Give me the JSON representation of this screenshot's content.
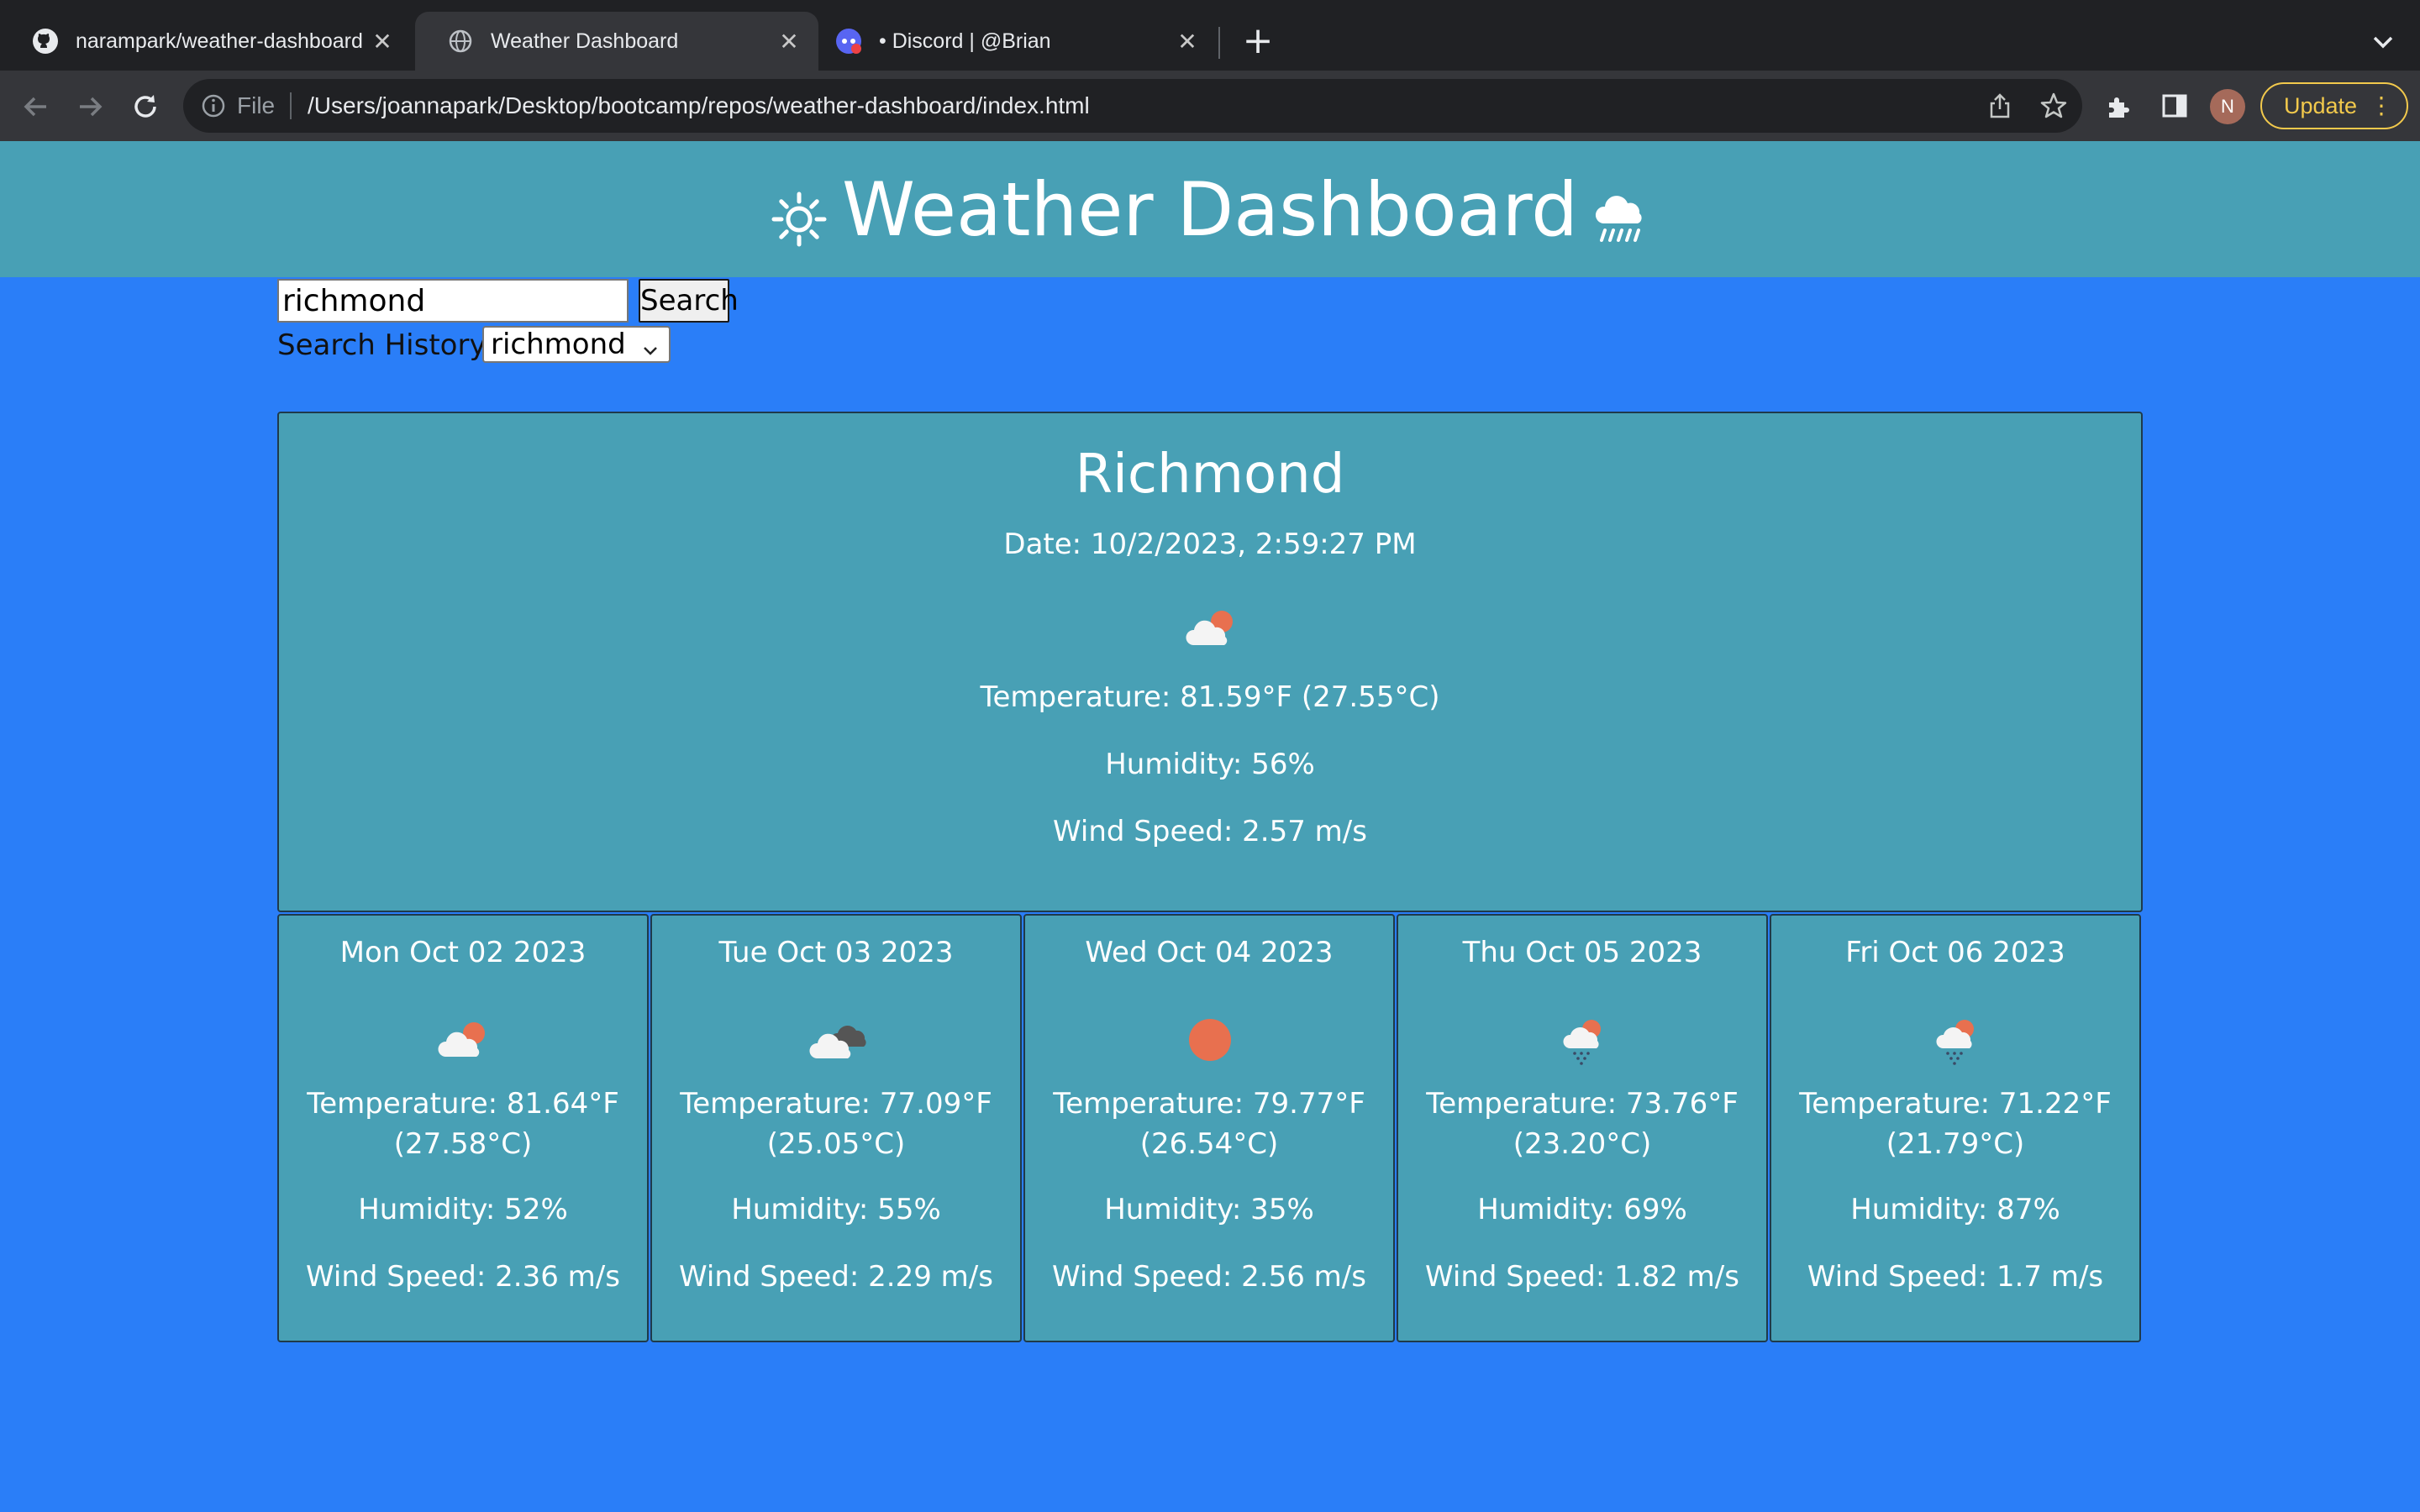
{
  "browser": {
    "tabs": [
      {
        "title": "narampark/weather-dashboard",
        "icon": "github-icon",
        "active": false
      },
      {
        "title": "Weather Dashboard",
        "icon": "globe-icon",
        "active": true
      },
      {
        "title": "• Discord | @Brian",
        "icon": "discord-icon",
        "active": false
      }
    ],
    "new_tab": "+",
    "omnibox": {
      "scheme_label": "File",
      "url": "/Users/joannapark/Desktop/bootcamp/repos/weather-dashboard/index.html"
    },
    "avatar_initial": "N",
    "update_label": "Update",
    "update_menu": "⋮"
  },
  "page": {
    "header_title": "Weather Dashboard",
    "search": {
      "value": "richmond",
      "button_label": "Search"
    },
    "history": {
      "label": "Search History:",
      "selected": "richmond"
    },
    "current": {
      "city": "Richmond",
      "date": "Date: 10/2/2023, 2:59:27 PM",
      "icon": "partly-cloudy-icon",
      "temperature": "Temperature: 81.59°F (27.55°C)",
      "humidity": "Humidity: 56%",
      "wind": "Wind Speed: 2.57 m/s"
    },
    "forecast": [
      {
        "date": "Mon Oct 02 2023",
        "icon": "partly-cloudy-icon",
        "temp_f": "Temperature: 81.64°F",
        "temp_c": "(27.58°C)",
        "humidity": "Humidity: 52%",
        "wind": "Wind Speed: 2.36 m/s"
      },
      {
        "date": "Tue Oct 03 2023",
        "icon": "broken-clouds-icon",
        "temp_f": "Temperature: 77.09°F",
        "temp_c": "(25.05°C)",
        "humidity": "Humidity: 55%",
        "wind": "Wind Speed: 2.29 m/s"
      },
      {
        "date": "Wed Oct 04 2023",
        "icon": "clear-sun-icon",
        "temp_f": "Temperature: 79.77°F",
        "temp_c": "(26.54°C)",
        "humidity": "Humidity: 35%",
        "wind": "Wind Speed: 2.56 m/s"
      },
      {
        "date": "Thu Oct 05 2023",
        "icon": "rain-cloud-icon",
        "temp_f": "Temperature: 73.76°F",
        "temp_c": "(23.20°C)",
        "humidity": "Humidity: 69%",
        "wind": "Wind Speed: 1.82 m/s"
      },
      {
        "date": "Fri Oct 06 2023",
        "icon": "rain-cloud-icon",
        "temp_f": "Temperature: 71.22°F",
        "temp_c": "(21.79°C)",
        "humidity": "Humidity: 87%",
        "wind": "Wind Speed: 1.7 m/s"
      }
    ]
  },
  "colors": {
    "page_bg": "#2a7ef8",
    "card_bg": "#48a0b5",
    "sun": "#e8704f",
    "update_accent": "#f2c94c"
  }
}
